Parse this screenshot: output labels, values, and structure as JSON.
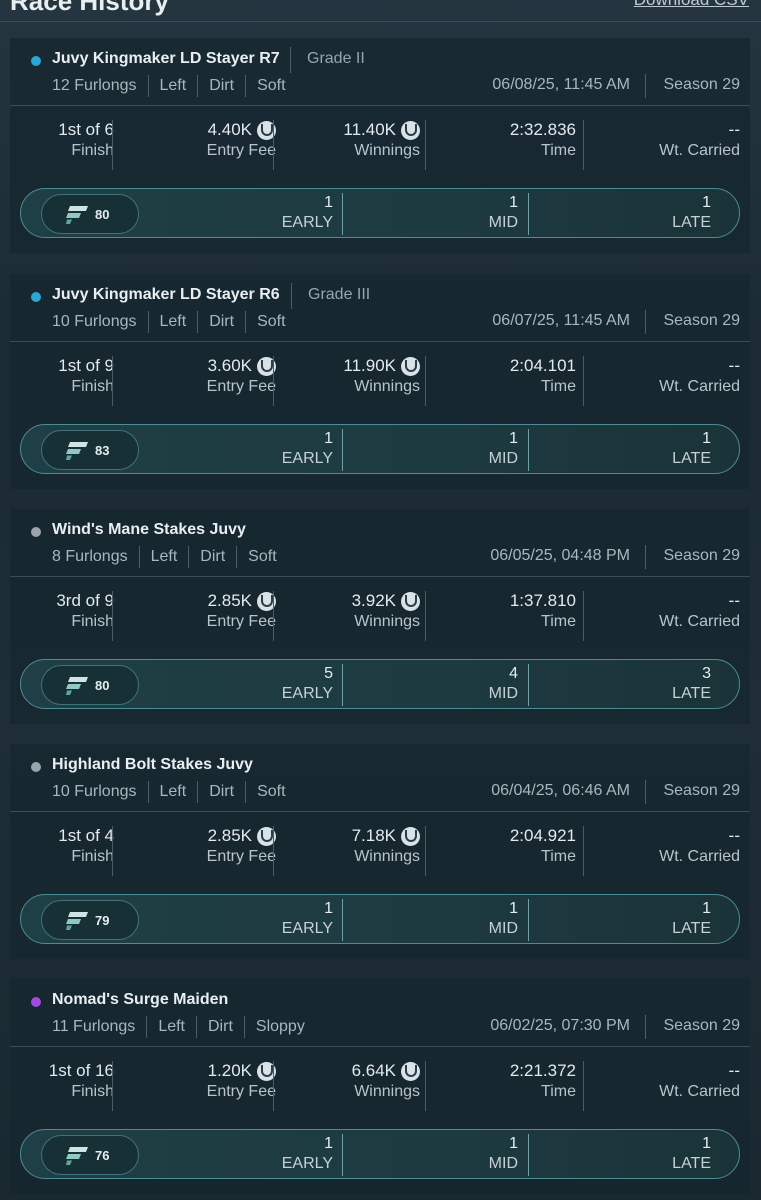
{
  "header": {
    "title": "Race History",
    "download_label": "Download CSV"
  },
  "labels": {
    "finish": "Finish",
    "entry_fee": "Entry Fee",
    "winnings": "Winnings",
    "time": "Time",
    "wt_carried": "Wt. Carried",
    "early": "EARLY",
    "mid": "MID",
    "late": "LATE"
  },
  "colors": {
    "dot_blue": "#2aa7d4",
    "dot_gray": "#9aa4aa",
    "dot_purple": "#a14be0",
    "accent_teal": "#4c8c94"
  },
  "races": [
    {
      "name": "Juvy Kingmaker LD Stayer R7",
      "grade": "Grade II",
      "dot": "blue",
      "distance": "12 Furlongs",
      "direction": "Left",
      "surface": "Dirt",
      "going": "Soft",
      "date": "06/08/25, 11:45 AM",
      "season": "Season 29",
      "finish": "1st of 6",
      "entry_fee": "4.40K",
      "winnings": "11.40K",
      "time": "2:32.836",
      "wt_carried": "--",
      "rating": "80",
      "early": "1",
      "mid": "1",
      "late": "1"
    },
    {
      "name": "Juvy Kingmaker LD Stayer R6",
      "grade": "Grade III",
      "dot": "blue",
      "distance": "10 Furlongs",
      "direction": "Left",
      "surface": "Dirt",
      "going": "Soft",
      "date": "06/07/25, 11:45 AM",
      "season": "Season 29",
      "finish": "1st of 9",
      "entry_fee": "3.60K",
      "winnings": "11.90K",
      "time": "2:04.101",
      "wt_carried": "--",
      "rating": "83",
      "early": "1",
      "mid": "1",
      "late": "1"
    },
    {
      "name": "Wind's Mane Stakes Juvy",
      "grade": "",
      "dot": "gray",
      "distance": "8 Furlongs",
      "direction": "Left",
      "surface": "Dirt",
      "going": "Soft",
      "date": "06/05/25, 04:48 PM",
      "season": "Season 29",
      "finish": "3rd of 9",
      "entry_fee": "2.85K",
      "winnings": "3.92K",
      "time": "1:37.810",
      "wt_carried": "--",
      "rating": "80",
      "early": "5",
      "mid": "4",
      "late": "3"
    },
    {
      "name": "Highland Bolt Stakes Juvy",
      "grade": "",
      "dot": "gray",
      "distance": "10 Furlongs",
      "direction": "Left",
      "surface": "Dirt",
      "going": "Soft",
      "date": "06/04/25, 06:46 AM",
      "season": "Season 29",
      "finish": "1st of 4",
      "entry_fee": "2.85K",
      "winnings": "7.18K",
      "time": "2:04.921",
      "wt_carried": "--",
      "rating": "79",
      "early": "1",
      "mid": "1",
      "late": "1"
    },
    {
      "name": "Nomad's Surge Maiden",
      "grade": "",
      "dot": "purple",
      "distance": "11 Furlongs",
      "direction": "Left",
      "surface": "Dirt",
      "going": "Sloppy",
      "date": "06/02/25, 07:30 PM",
      "season": "Season 29",
      "finish": "1st of 16",
      "entry_fee": "1.20K",
      "winnings": "6.64K",
      "time": "2:21.372",
      "wt_carried": "--",
      "rating": "76",
      "early": "1",
      "mid": "1",
      "late": "1"
    }
  ]
}
